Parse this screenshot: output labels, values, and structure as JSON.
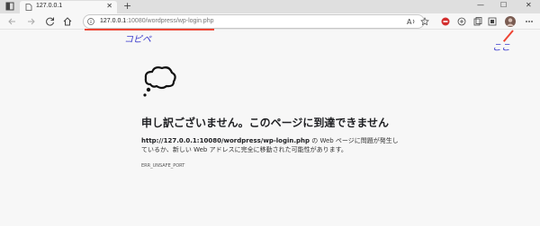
{
  "tab": {
    "title": "127.0.0.1"
  },
  "address_bar": {
    "url_host": "127.0.0.1",
    "url_rest": ":10080/wordpress/wp-login.php"
  },
  "annotations": {
    "copy_paste": "コピペ",
    "here": "ここ"
  },
  "error": {
    "heading": "申し訳ございません。このページに到達できません",
    "url": "http://127.0.0.1:10080/wordpress/wp-login.php",
    "message": " の Web ページに問題が発生しているか、新しい Web アドレスに完全に移動された可能性があります。",
    "code": "ERR_UNSAFE_PORT"
  },
  "colors": {
    "annotation_text": "#3a3acc",
    "annotation_line": "#ee4433",
    "profile": "#7a5c52",
    "extension_red": "#d32f2f"
  }
}
